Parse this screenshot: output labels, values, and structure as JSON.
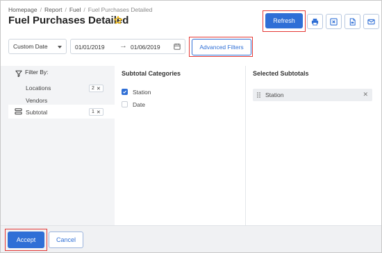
{
  "breadcrumb": {
    "items": [
      "Homepage",
      "Report",
      "Fuel"
    ],
    "current": "Fuel Purchases Detailed"
  },
  "page": {
    "title": "Fuel Purchases Detailed",
    "favorite_icon": "star-outline-icon",
    "favorite_color": "#f2b705"
  },
  "toolbar": {
    "refresh_label": "Refresh",
    "icons": [
      "print-icon",
      "excel-export-icon",
      "pdf-export-icon",
      "email-icon"
    ]
  },
  "filters": {
    "range_type": "Custom Date",
    "date_from": "01/01/2019",
    "date_to": "01/06/2019",
    "advanced_label": "Advanced Filters"
  },
  "sidebar": {
    "heading": "Filter By:",
    "items": [
      {
        "label": "Locations",
        "count": "2"
      },
      {
        "label": "Vendors",
        "count": ""
      },
      {
        "label": "Subtotal",
        "count": "1"
      }
    ]
  },
  "subtotal_categories": {
    "title": "Subtotal Categories",
    "options": [
      {
        "label": "Station",
        "checked": true
      },
      {
        "label": "Date",
        "checked": false
      }
    ]
  },
  "selected_subtotals": {
    "title": "Selected Subtotals",
    "items": [
      {
        "label": "Station"
      }
    ]
  },
  "footer": {
    "accept_label": "Accept",
    "cancel_label": "Cancel"
  },
  "colors": {
    "primary": "#2f6fd6",
    "highlight": "#e53935",
    "panel_bg": "#f3f4f6"
  }
}
